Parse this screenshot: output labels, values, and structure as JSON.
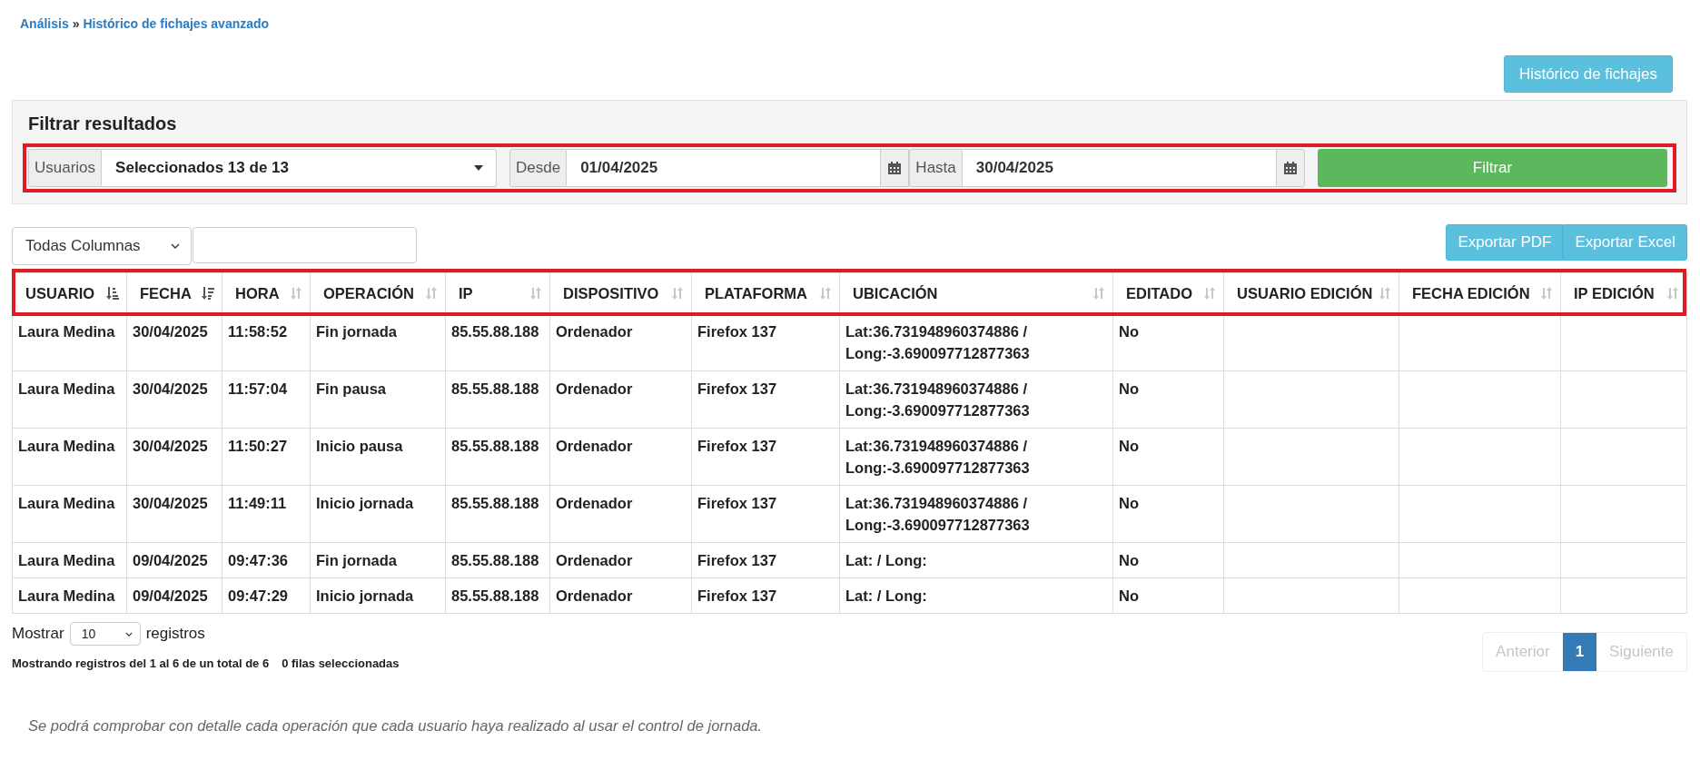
{
  "breadcrumb": {
    "items": [
      {
        "label": "Análisis"
      },
      {
        "label": "Histórico de fichajes avanzado"
      }
    ],
    "separator": "»"
  },
  "header_button": "Histórico de fichajes",
  "filter": {
    "title": "Filtrar resultados",
    "users": {
      "label": "Usuarios",
      "value": "Seleccionados 13 de 13"
    },
    "from": {
      "label": "Desde",
      "value": "01/04/2025"
    },
    "to": {
      "label": "Hasta",
      "value": "30/04/2025"
    },
    "submit": "Filtrar"
  },
  "toolbar": {
    "column_select": "Todas Columnas"
  },
  "export_buttons": [
    "Exportar PDF",
    "Exportar Excel"
  ],
  "table": {
    "columns": [
      {
        "label": "USUARIO",
        "kind": "ascending"
      },
      {
        "label": "FECHA",
        "kind": "descending"
      },
      {
        "label": "HORA",
        "kind": "unsorted"
      },
      {
        "label": "OPERACIÓN",
        "kind": "unsorted"
      },
      {
        "label": "IP",
        "kind": "unsorted"
      },
      {
        "label": "DISPOSITIVO",
        "kind": "unsorted"
      },
      {
        "label": "PLATAFORMA",
        "kind": "unsorted"
      },
      {
        "label": "UBICACIÓN",
        "kind": "unsorted"
      },
      {
        "label": "EDITADO",
        "kind": "unsorted"
      },
      {
        "label": "USUARIO EDICIÓN",
        "kind": "unsorted"
      },
      {
        "label": "FECHA EDICIÓN",
        "kind": "unsorted"
      },
      {
        "label": "IP EDICIÓN",
        "kind": "unsorted"
      }
    ],
    "rows": [
      [
        "Laura Medina",
        "30/04/2025",
        "11:58:52",
        "Fin jornada",
        "85.55.88.188",
        "Ordenador",
        "Firefox 137",
        "Lat:36.731948960374886 / Long:-3.690097712877363",
        "No"
      ],
      [
        "Laura Medina",
        "30/04/2025",
        "11:57:04",
        "Fin pausa",
        "85.55.88.188",
        "Ordenador",
        "Firefox 137",
        "Lat:36.731948960374886 / Long:-3.690097712877363",
        "No"
      ],
      [
        "Laura Medina",
        "30/04/2025",
        "11:50:27",
        "Inicio pausa",
        "85.55.88.188",
        "Ordenador",
        "Firefox 137",
        "Lat:36.731948960374886 / Long:-3.690097712877363",
        "No"
      ],
      [
        "Laura Medina",
        "30/04/2025",
        "11:49:11",
        "Inicio jornada",
        "85.55.88.188",
        "Ordenador",
        "Firefox 137",
        "Lat:36.731948960374886 / Long:-3.690097712877363",
        "No"
      ],
      [
        "Laura Medina",
        "09/04/2025",
        "09:47:36",
        "Fin jornada",
        "85.55.88.188",
        "Ordenador",
        "Firefox 137",
        "Lat: / Long:",
        "No"
      ],
      [
        "Laura Medina",
        "09/04/2025",
        "09:47:29",
        "Inicio jornada",
        "85.55.88.188",
        "Ordenador",
        "Firefox 137",
        "Lat: / Long:",
        "No"
      ]
    ]
  },
  "page_length": {
    "label_before": "Mostrar",
    "value": "10",
    "label_after": "registros"
  },
  "info": "Mostrando registros del 1 al 6 de un total de 6",
  "selection_info": "0 filas seleccionadas",
  "pagination": {
    "previous": {
      "label": "Anterior",
      "disabled": true
    },
    "pages": [
      {
        "label": "1",
        "selected": true
      }
    ],
    "next": {
      "label": "Siguiente",
      "disabled": true
    }
  },
  "footer_note": "Se podrá comprobar con detalle cada operación que cada usuario haya realizado al usar el control de jornada."
}
